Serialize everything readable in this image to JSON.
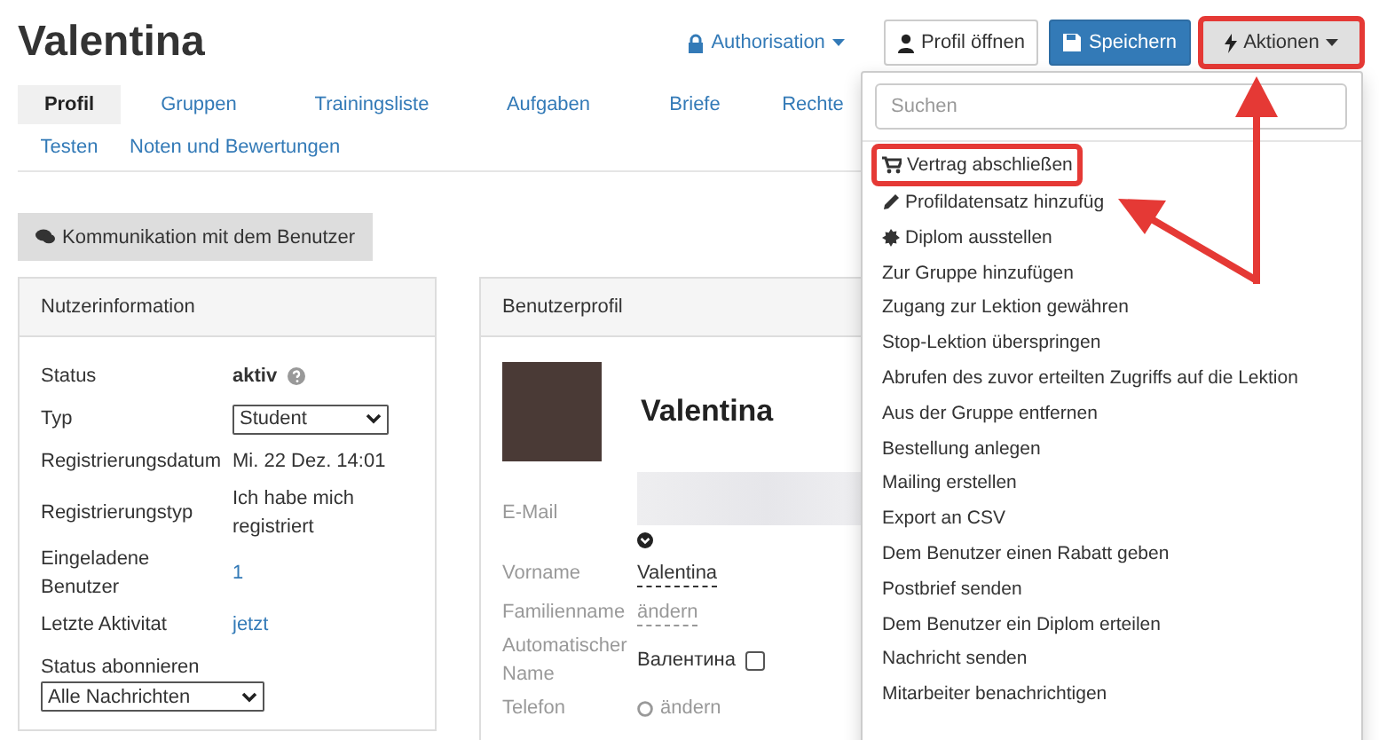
{
  "title": "Valentina",
  "header_actions": {
    "authorisation": "Authorisation",
    "open_profile": "Profil öffnen",
    "save": "Speichern",
    "actions": "Aktionen",
    "actions_highlighted": true
  },
  "tabs": [
    {
      "label": "Profil",
      "selected": true
    },
    {
      "label": "Gruppen",
      "selected": false
    },
    {
      "label": "Trainingsliste",
      "selected": false
    },
    {
      "label": "Aufgaben",
      "selected": false
    },
    {
      "label": "Briefe",
      "selected": false
    },
    {
      "label": "Rechte",
      "selected": false
    },
    {
      "label": "Testen",
      "selected": false
    },
    {
      "label": "Noten und Bewertungen",
      "selected": false
    }
  ],
  "communication_button": "Kommunikation mit dem Benutzer",
  "user_info": {
    "title": "Nutzerinformation",
    "rows": [
      {
        "kind": "status",
        "label": "Status",
        "value": "aktiv"
      },
      {
        "kind": "select",
        "label": "Typ",
        "value": "Student"
      },
      {
        "kind": "text",
        "label": "Registrierungsdatum",
        "value": "Mi. 22 Dez. 14:01"
      },
      {
        "kind": "text",
        "label": "Registrierungstyp",
        "value": "Ich habe mich registriert"
      },
      {
        "kind": "link",
        "label": "Eingeladene Benutzer",
        "value": "1"
      },
      {
        "kind": "link",
        "label": "Letzte Aktivitat",
        "value": "jetzt"
      }
    ],
    "subscribe": {
      "label": "Status abonnieren",
      "value": "Alle Nachrichten"
    }
  },
  "profile": {
    "title": "Benutzerprofil",
    "name": "Valentina",
    "fields": [
      {
        "kind": "email",
        "label": "E-Mail"
      },
      {
        "kind": "editable",
        "label": "Vorname",
        "value": "Valentina"
      },
      {
        "kind": "empty",
        "label": "Familienname",
        "value": "ändern"
      },
      {
        "kind": "checkbox",
        "label": "Automatischer Name",
        "value": "Валентина",
        "checked": false
      },
      {
        "kind": "phone",
        "label": "Telefon",
        "value": "ändern"
      }
    ]
  },
  "actions_menu": {
    "search_placeholder": "Suchen",
    "items": [
      {
        "label": "Vertrag abschließen",
        "kind": "cart",
        "highlighted": true
      },
      {
        "label": "Profildatensatz hinzufüg",
        "kind": "pencil",
        "highlighted": false
      },
      {
        "label": "Diplom ausstellen",
        "kind": "badge",
        "highlighted": false
      },
      {
        "label": "Zur Gruppe hinzufügen",
        "kind": "plain",
        "highlighted": false
      },
      {
        "label": "Zugang zur Lektion gewähren",
        "kind": "plain",
        "highlighted": false
      },
      {
        "label": "Stop-Lektion überspringen",
        "kind": "plain",
        "highlighted": false
      },
      {
        "label": "Abrufen des zuvor erteilten Zugriffs auf die Lektion",
        "kind": "plain",
        "highlighted": false
      },
      {
        "label": "Aus der Gruppe entfernen",
        "kind": "plain",
        "highlighted": false
      },
      {
        "label": "Bestellung anlegen",
        "kind": "plain",
        "highlighted": false
      },
      {
        "label": "Mailing erstellen",
        "kind": "plain",
        "highlighted": false
      },
      {
        "label": "Export an CSV",
        "kind": "plain",
        "highlighted": false
      },
      {
        "label": "Dem Benutzer einen Rabatt geben",
        "kind": "plain",
        "highlighted": false
      },
      {
        "label": "Postbrief senden",
        "kind": "plain",
        "highlighted": false
      },
      {
        "label": "Dem Benutzer ein Diplom erteilen",
        "kind": "plain",
        "highlighted": false
      },
      {
        "label": "Nachricht senden",
        "kind": "plain",
        "highlighted": false
      },
      {
        "label": "Mitarbeiter benachrichtigen",
        "kind": "plain",
        "highlighted": false
      }
    ]
  }
}
